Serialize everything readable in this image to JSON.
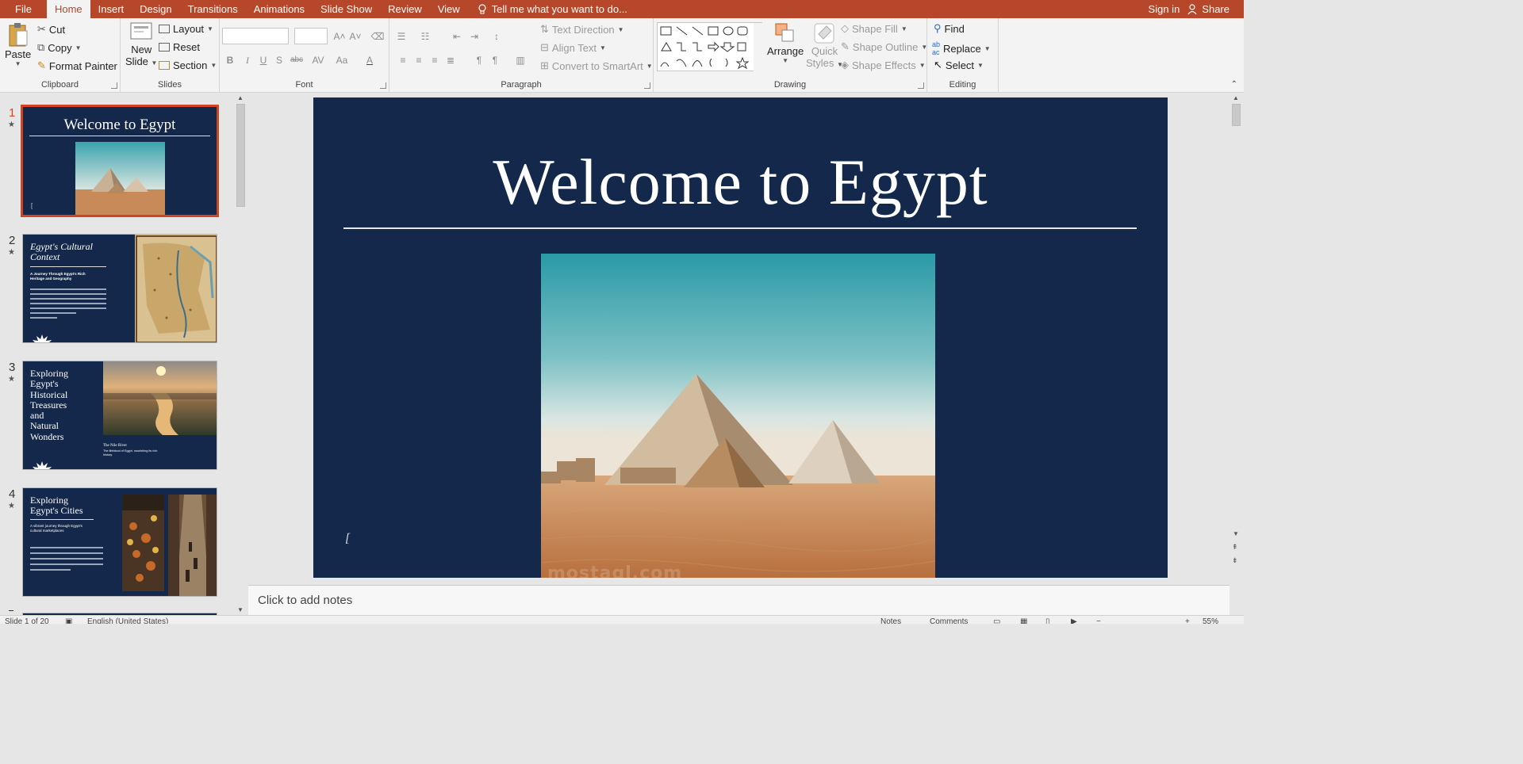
{
  "menubar": {
    "file": "File",
    "tabs": [
      "Home",
      "Insert",
      "Design",
      "Transitions",
      "Animations",
      "Slide Show",
      "Review",
      "View"
    ],
    "tell_me": "Tell me what you want to do...",
    "sign_in": "Sign in",
    "share": "Share"
  },
  "ribbon": {
    "clipboard": {
      "paste": "Paste",
      "cut": "Cut",
      "copy": "Copy",
      "format_painter": "Format Painter",
      "label": "Clipboard"
    },
    "slides": {
      "new_slide_1": "New",
      "new_slide_2": "Slide",
      "layout": "Layout",
      "reset": "Reset",
      "section": "Section",
      "label": "Slides"
    },
    "font": {
      "label": "Font",
      "bold": "B",
      "italic": "I",
      "underline": "U",
      "shadow": "S",
      "strike": "abc",
      "spacing": "AV",
      "case": "Aa",
      "color": "A"
    },
    "paragraph": {
      "text_direction": "Text Direction",
      "align_text": "Align Text",
      "convert_smartart": "Convert to SmartArt",
      "label": "Paragraph"
    },
    "drawing": {
      "arrange": "Arrange",
      "quick_styles_1": "Quick",
      "quick_styles_2": "Styles",
      "shape_fill": "Shape Fill",
      "shape_outline": "Shape Outline",
      "shape_effects": "Shape Effects",
      "label": "Drawing"
    },
    "editing": {
      "find": "Find",
      "replace": "Replace",
      "select": "Select",
      "label": "Editing"
    }
  },
  "thumbnails": [
    {
      "number": "1",
      "title": "Welcome to Egypt",
      "selected": true
    },
    {
      "number": "2",
      "title_1": "Egypt's Cultural",
      "title_2": "Context",
      "subtitle_1": "A Journey Through Egypt's Rich",
      "subtitle_2": "Heritage and Geography"
    },
    {
      "number": "3",
      "title_lines": [
        "Exploring",
        "Egypt's",
        "Historical",
        "Treasures",
        "and",
        "Natural",
        "Wonders"
      ],
      "caption": "The Nile River",
      "caption_sub_1": "The lifeblood of Egypt, nourishing its rich",
      "caption_sub_2": "history."
    },
    {
      "number": "4",
      "title_1": "Exploring",
      "title_2": "Egypt's Cities",
      "subtitle_1": "A vibrant journey through Egypt's",
      "subtitle_2": "cultural marketplaces"
    }
  ],
  "slide": {
    "title": "Welcome to Egypt",
    "cursor": "["
  },
  "notes": {
    "placeholder": "Click to add notes"
  },
  "status": {
    "slide_counter": "Slide 1 of 20",
    "language": "English (United States)",
    "notes": "Notes",
    "comments": "Comments",
    "zoom": "55%"
  },
  "watermark": "mostaql.com",
  "colors": {
    "accent": "#b7472a",
    "slide_bg": "#13284a",
    "selection": "#d04424"
  }
}
